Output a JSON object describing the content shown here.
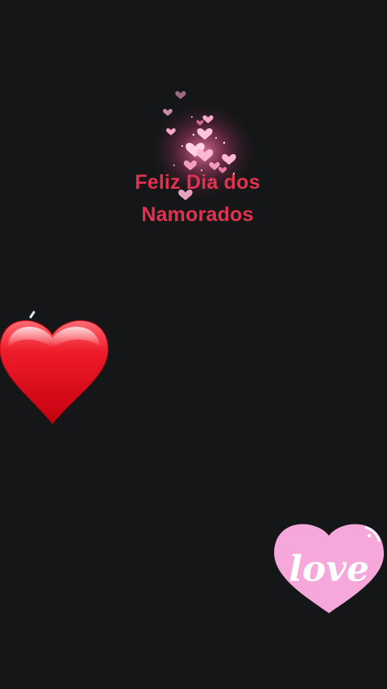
{
  "greeting": {
    "line1": "Feliz Dia dos",
    "line2": "Namorados"
  },
  "stickers": {
    "love_label": "love"
  },
  "colors": {
    "background": "#151617",
    "greeting_text": "#e1334f",
    "red_heart": "#e0101e",
    "pink_heart": "#f7a8da"
  },
  "icons": {
    "sparkle": "sparkling-hearts-icon",
    "red": "red-heart-icon",
    "love": "love-heart-sticker-icon"
  }
}
